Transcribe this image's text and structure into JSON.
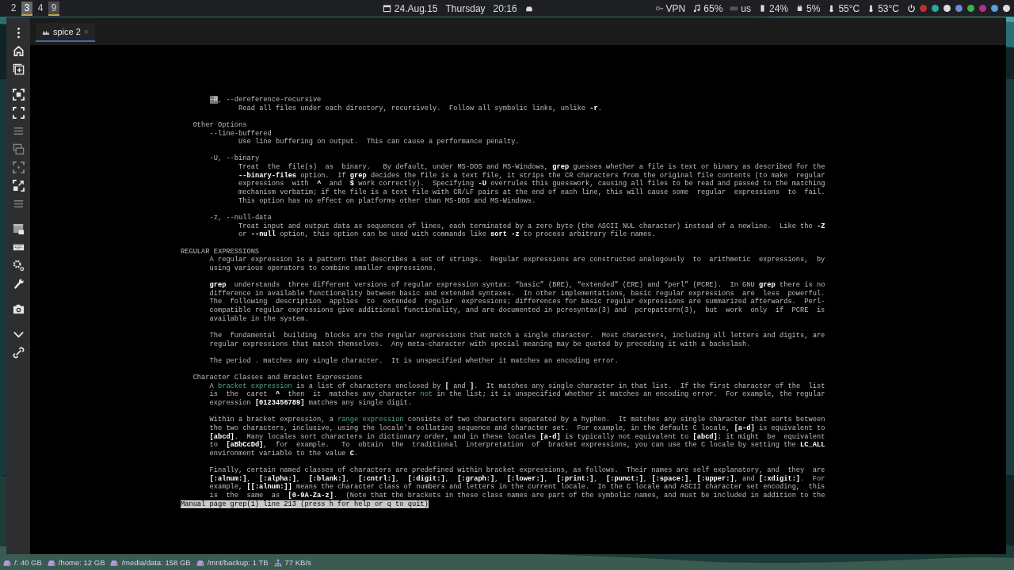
{
  "top_bar": {
    "workspaces": [
      {
        "label": "2",
        "active": false,
        "focused": false
      },
      {
        "label": "3",
        "active": true,
        "focused": true
      },
      {
        "label": "4",
        "active": false,
        "focused": false
      },
      {
        "label": "9",
        "active": true,
        "focused": false
      }
    ],
    "clock": {
      "date": "24.Aug.15",
      "day": "Thursday",
      "time": "20:16"
    },
    "status_items": [
      {
        "kind": "vpn",
        "text": "VPN"
      },
      {
        "kind": "volume",
        "text": "65%"
      },
      {
        "kind": "keyboard",
        "text": "us"
      },
      {
        "kind": "memory",
        "text": "24%"
      },
      {
        "kind": "cpu",
        "text": "5%"
      },
      {
        "kind": "temperature",
        "text": "55°C"
      },
      {
        "kind": "temperature",
        "text": "53°C"
      }
    ]
  },
  "toolbar": [
    {
      "disabled": false
    },
    {
      "disabled": false
    },
    {
      "disabled": false
    },
    {
      "disabled": false
    },
    {
      "disabled": false
    },
    {
      "disabled": true
    },
    {
      "disabled": true
    },
    {
      "disabled": true
    },
    {
      "disabled": false
    },
    {
      "disabled": true
    },
    {
      "disabled": false
    },
    {
      "disabled": false
    },
    {
      "disabled": false
    },
    {
      "disabled": false
    },
    {
      "disabled": false
    },
    {
      "disabled": false
    },
    {
      "disabled": false
    }
  ],
  "tabs": [
    {
      "label": "spice 2",
      "close": "×",
      "selected": true
    }
  ],
  "man_page": {
    "blocks": [
      [
        {
          "kind": "option",
          "highlight": "-R",
          "text": ", --dereference-recursive"
        },
        {
          "kind": "body",
          "text": "Read all files under each directory, recursively.  Follow all symbolic links, unlike **-r**."
        }
      ],
      [
        {
          "kind": "subheading",
          "text": "Other Options"
        },
        {
          "kind": "option",
          "text": "--line-buffered"
        },
        {
          "kind": "body",
          "text": "Use line buffering on output.  This can cause a performance penalty."
        }
      ],
      [
        {
          "kind": "option",
          "text": "-U, --binary"
        },
        {
          "kind": "body",
          "text": "Treat  the  file(s)  as  binary.   By default, under MS-DOS and MS-Windows, **grep** guesses whether a file is text or binary as described for the"
        },
        {
          "kind": "body",
          "text": "**--binary-files** option.  If **grep** decides the file is a text file, it strips the CR characters from the original file contents (to make  regular"
        },
        {
          "kind": "body",
          "text": "expressions  with  **^**  and  **$** work correctly).  Specifying **-U** overrules this guesswork, causing all files to be read and passed to the matching"
        },
        {
          "kind": "body",
          "text": "mechanism verbatim; if the file is a text file with CR/LF pairs at the end of each line, this will cause some  regular  expressions  to  fail."
        },
        {
          "kind": "body",
          "text": "This option has no effect on platforms other than MS-DOS and MS-Windows."
        }
      ],
      [
        {
          "kind": "option",
          "text": "-z, --null-data"
        },
        {
          "kind": "body",
          "text": "Treat input and output data as sequences of lines, each terminated by a zero byte (the ASCII NUL character) instead of a newline.  Like the **-Z**"
        },
        {
          "kind": "body",
          "text": "or **--null** option, this option can be used with commands like **sort -z** to process arbitrary file names."
        }
      ],
      [
        {
          "kind": "heading",
          "text": "REGULAR EXPRESSIONS"
        },
        {
          "kind": "para",
          "text": "A regular expression is a pattern that describes a set of strings.  Regular expressions are constructed analogously  to  arithmetic  expressions,  by"
        },
        {
          "kind": "para",
          "text": "using various operators to combine smaller expressions."
        }
      ],
      [
        {
          "kind": "para",
          "text": "**grep**  understands  three different versions of regular expression syntax: “basic” (BRE), “extended” (ERE) and “perl” (PCRE).  In GNU **grep** there is no"
        },
        {
          "kind": "para",
          "text": "difference in available functionality between basic and extended syntaxes.  In other implementations, basic regular expressions  are  less  powerful."
        },
        {
          "kind": "para",
          "text": "The  following  description  applies  to  extended  regular  expressions; differences for basic regular expressions are summarized afterwards.  Perl-"
        },
        {
          "kind": "para",
          "text": "compatible regular expressions give additional functionality, and are documented in pcresyntax(3) and  pcrepattern(3),  but  work  only  if  PCRE  is"
        },
        {
          "kind": "para",
          "text": "available in the system."
        }
      ],
      [
        {
          "kind": "para",
          "text": "The  fundamental  building  blocks are the regular expressions that match a single character.  Most characters, including all letters and digits, are"
        },
        {
          "kind": "para",
          "text": "regular expressions that match themselves.  Any meta-character with special meaning may be quoted by preceding it with a backslash."
        }
      ],
      [
        {
          "kind": "para",
          "text": "The period . matches any single character.  It is unspecified whether it matches an encoding error."
        }
      ],
      [
        {
          "kind": "subheading",
          "text": "Character Classes and Bracket Expressions"
        },
        {
          "kind": "para",
          "text": "A *bracket expression* is a list of characters enclosed by **[** and **]**.  It matches any single character in that list.  If the first character of the  list"
        },
        {
          "kind": "para",
          "text": "is  the  caret  **^**  then  it  matches any character *not* in the list; it is unspecified whether it matches an encoding error.  For example, the regular"
        },
        {
          "kind": "para",
          "text": "expression **[0123456789]** matches any single digit."
        }
      ],
      [
        {
          "kind": "para",
          "text": "Within a bracket expression, a *range expression* consists of two characters separated by a hyphen.  It matches any single character that sorts between"
        },
        {
          "kind": "para",
          "text": "the two characters, inclusive, using the locale's collating sequence and character set.  For example, in the default C locale, **[a-d]** is equivalent to"
        },
        {
          "kind": "para",
          "text": "**[abcd]**.  Many locales sort characters in dictionary order, and in these locales **[a-d]** is typically not equivalent to **[abcd]**; it might  be  equivalent"
        },
        {
          "kind": "para",
          "text": "to  **[aBbCcDd]**,  for  example.   To  obtain  the  traditional  interpretation  of  bracket expressions, you can use the C locale by setting the **LC_ALL**"
        },
        {
          "kind": "para",
          "text": "environment variable to the value **C**."
        }
      ],
      [
        {
          "kind": "para",
          "text": "Finally, certain named classes of characters are predefined within bracket expressions, as follows.  Their names are self explanatory, and  they  are"
        },
        {
          "kind": "para",
          "text": "**[:alnum:]**,  **[:alpha:]**,  **[:blank:]**,  **[:cntrl:]**,  **[:digit:]**,  **[:graph:]**,  **[:lower:]**,  **[:print:]**,  **[:punct:]**, **[:space:]**, **[:upper:]**, and **[:xdigit:]**.  For"
        },
        {
          "kind": "para",
          "text": "example, **[[:alnum:]]** means the character class of numbers and letters in the current locale.  In the C locale and ASCII character set encoding,  this"
        },
        {
          "kind": "para",
          "text": "is  the  same  as  **[0-9A-Za-z]**.  (Note that the brackets in these class names are part of the symbolic names, and must be included in addition to the"
        }
      ]
    ],
    "status_line": "Manual page grep(1) line 213 (press h for help or q to quit)"
  },
  "bottom_bar": [
    {
      "kind": "disk",
      "text": "/: 40 GB"
    },
    {
      "kind": "disk",
      "text": "/home: 12 GB"
    },
    {
      "kind": "disk",
      "text": "/media/data: 158 GB"
    },
    {
      "kind": "disk",
      "text": "/mnt/backup: 1 TB"
    },
    {
      "kind": "network",
      "text": "77 KB/s"
    }
  ]
}
